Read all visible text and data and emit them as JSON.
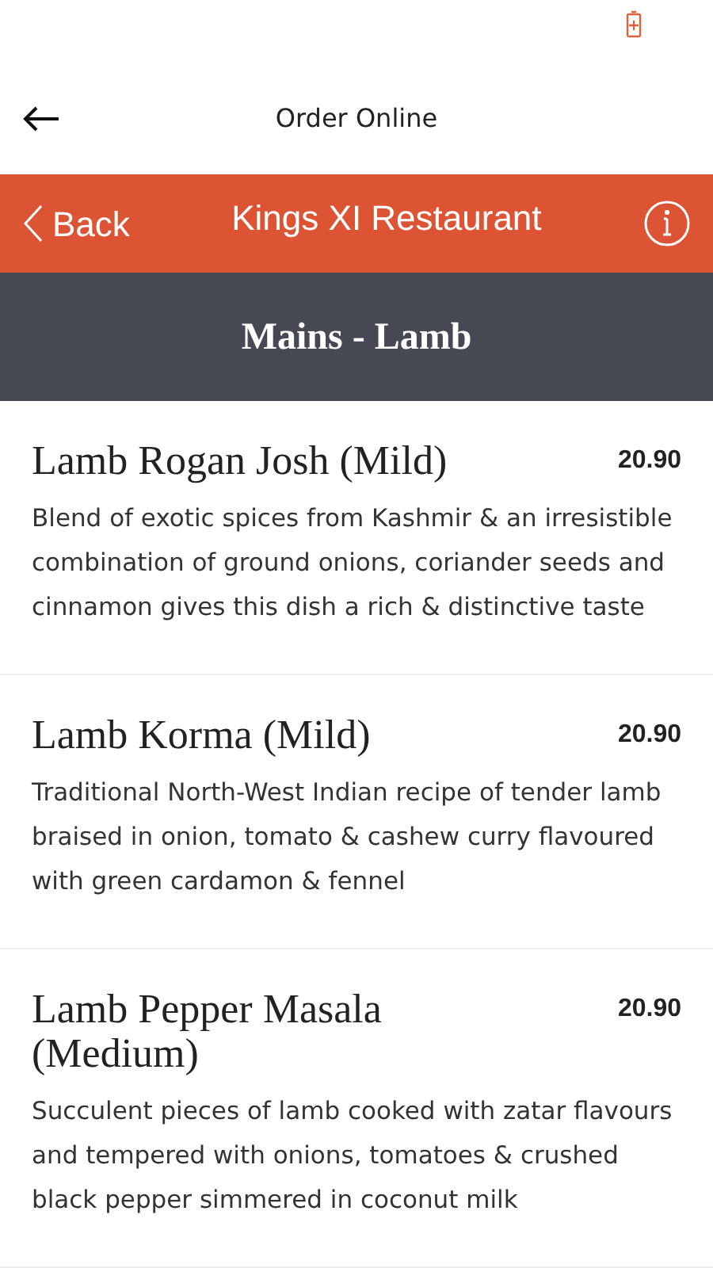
{
  "app_bar": {
    "title": "Order Online"
  },
  "restaurant_bar": {
    "back_label": "Back",
    "title": "Kings XI Restaurant"
  },
  "category": {
    "title": "Mains - Lamb"
  },
  "items": [
    {
      "name": "Lamb Rogan Josh (Mild)",
      "price": "20.90",
      "description": "Blend of exotic spices from Kashmir & an irresistible combination of ground onions, coriander seeds and cinnamon gives this dish a rich & distinctive taste"
    },
    {
      "name": "Lamb Korma (Mild)",
      "price": "20.90",
      "description": "Traditional North-West Indian recipe of tender lamb braised in onion, tomato & cashew curry flavoured with green cardamon & fennel"
    },
    {
      "name": "Lamb Pepper Masala (Medium)",
      "price": "20.90",
      "description": "Succulent pieces of lamb cooked with zatar flavours and tempered with onions, tomatoes & crushed black pepper simmered in coconut milk"
    }
  ]
}
